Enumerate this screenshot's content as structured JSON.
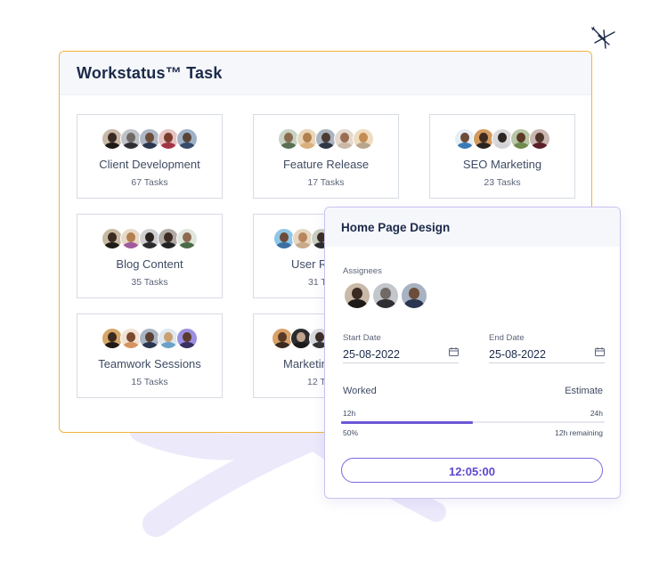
{
  "panel": {
    "title": "Workstatus™ Task"
  },
  "cards": [
    {
      "name": "Client Development",
      "count": "67 Tasks"
    },
    {
      "name": "Feature Release",
      "count": "17 Tasks"
    },
    {
      "name": "SEO Marketing",
      "count": "23 Tasks"
    },
    {
      "name": "Blog Content",
      "count": "35 Tasks"
    },
    {
      "name": "User R",
      "count": "31 T"
    },
    {
      "name": "Teamwork Sessions",
      "count": "15 Tasks"
    },
    {
      "name": "Marketin",
      "count": "12 T"
    }
  ],
  "popup": {
    "title": "Home Page Design",
    "assignees_label": "Assignees",
    "start_label": "Start Date",
    "start_value": "25-08-2022",
    "end_label": "End Date",
    "end_value": "25-08-2022",
    "worked_label": "Worked",
    "estimate_label": "Estimate",
    "worked_hours": "12h",
    "estimate_hours": "24h",
    "percent": "50%",
    "remaining": "12h remaining",
    "progress": 0.5,
    "timer": "12:05:00"
  },
  "colors": {
    "accent": "#6b57d6",
    "panel_border": "#f1b43a",
    "popup_border": "#c9c3f0"
  }
}
